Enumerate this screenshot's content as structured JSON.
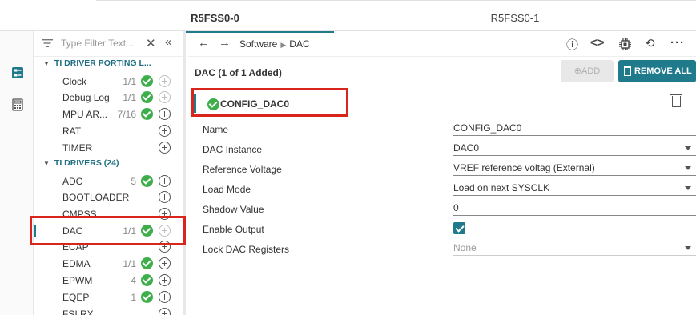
{
  "core_tabs": {
    "active": "R5FSS0-0",
    "inactive": "R5FSS0-1"
  },
  "sidebar": {
    "filter_placeholder": "Type Filter Text...",
    "groups": [
      {
        "label": "TI DRIVER PORTING L..."
      },
      {
        "label": "TI DRIVERS (24)"
      }
    ],
    "items": [
      {
        "label": "Clock",
        "count": "1/1",
        "status": "check"
      },
      {
        "label": "Debug Log",
        "count": "1/1",
        "status": "check"
      },
      {
        "label": "MPU AR...",
        "count": "7/16",
        "status": "check"
      },
      {
        "label": "RAT",
        "count": "",
        "status": "none"
      },
      {
        "label": "TIMER",
        "count": "",
        "status": "none"
      },
      {
        "label": "ADC",
        "count": "5",
        "status": "check"
      },
      {
        "label": "BOOTLOADER",
        "count": "",
        "status": "none"
      },
      {
        "label": "CMPSS",
        "count": "",
        "status": "none"
      },
      {
        "label": "DAC",
        "count": "1/1",
        "status": "check",
        "selected": true
      },
      {
        "label": "ECAP",
        "count": "",
        "status": "none"
      },
      {
        "label": "EDMA",
        "count": "1/1",
        "status": "check"
      },
      {
        "label": "EPWM",
        "count": "4",
        "status": "check"
      },
      {
        "label": "EQEP",
        "count": "1",
        "status": "check"
      },
      {
        "label": "FSI RX",
        "count": "",
        "status": "none"
      }
    ]
  },
  "breadcrumb": {
    "parent": "Software",
    "current": "DAC"
  },
  "panel": {
    "title": "DAC (1 of 1 Added)",
    "add_label": "ADD",
    "remove_all_label": "REMOVE ALL",
    "instance_name": "CONFIG_DAC0"
  },
  "properties": [
    {
      "label": "Name",
      "value": "CONFIG_DAC0",
      "kind": "text"
    },
    {
      "label": "DAC Instance",
      "value": "DAC0",
      "kind": "select"
    },
    {
      "label": "Reference Voltage",
      "value": "VREF reference voltag (External)",
      "kind": "select"
    },
    {
      "label": "Load Mode",
      "value": "Load on next SYSCLK",
      "kind": "select"
    },
    {
      "label": "Shadow Value",
      "value": "0",
      "kind": "text"
    },
    {
      "label": "Enable Output",
      "value": true,
      "kind": "checkbox"
    },
    {
      "label": "Lock DAC Registers",
      "value": "None",
      "kind": "select-none"
    }
  ],
  "colors": {
    "accent": "#1f7a8c",
    "success": "#3dae4a",
    "highlight": "#d9261c"
  }
}
